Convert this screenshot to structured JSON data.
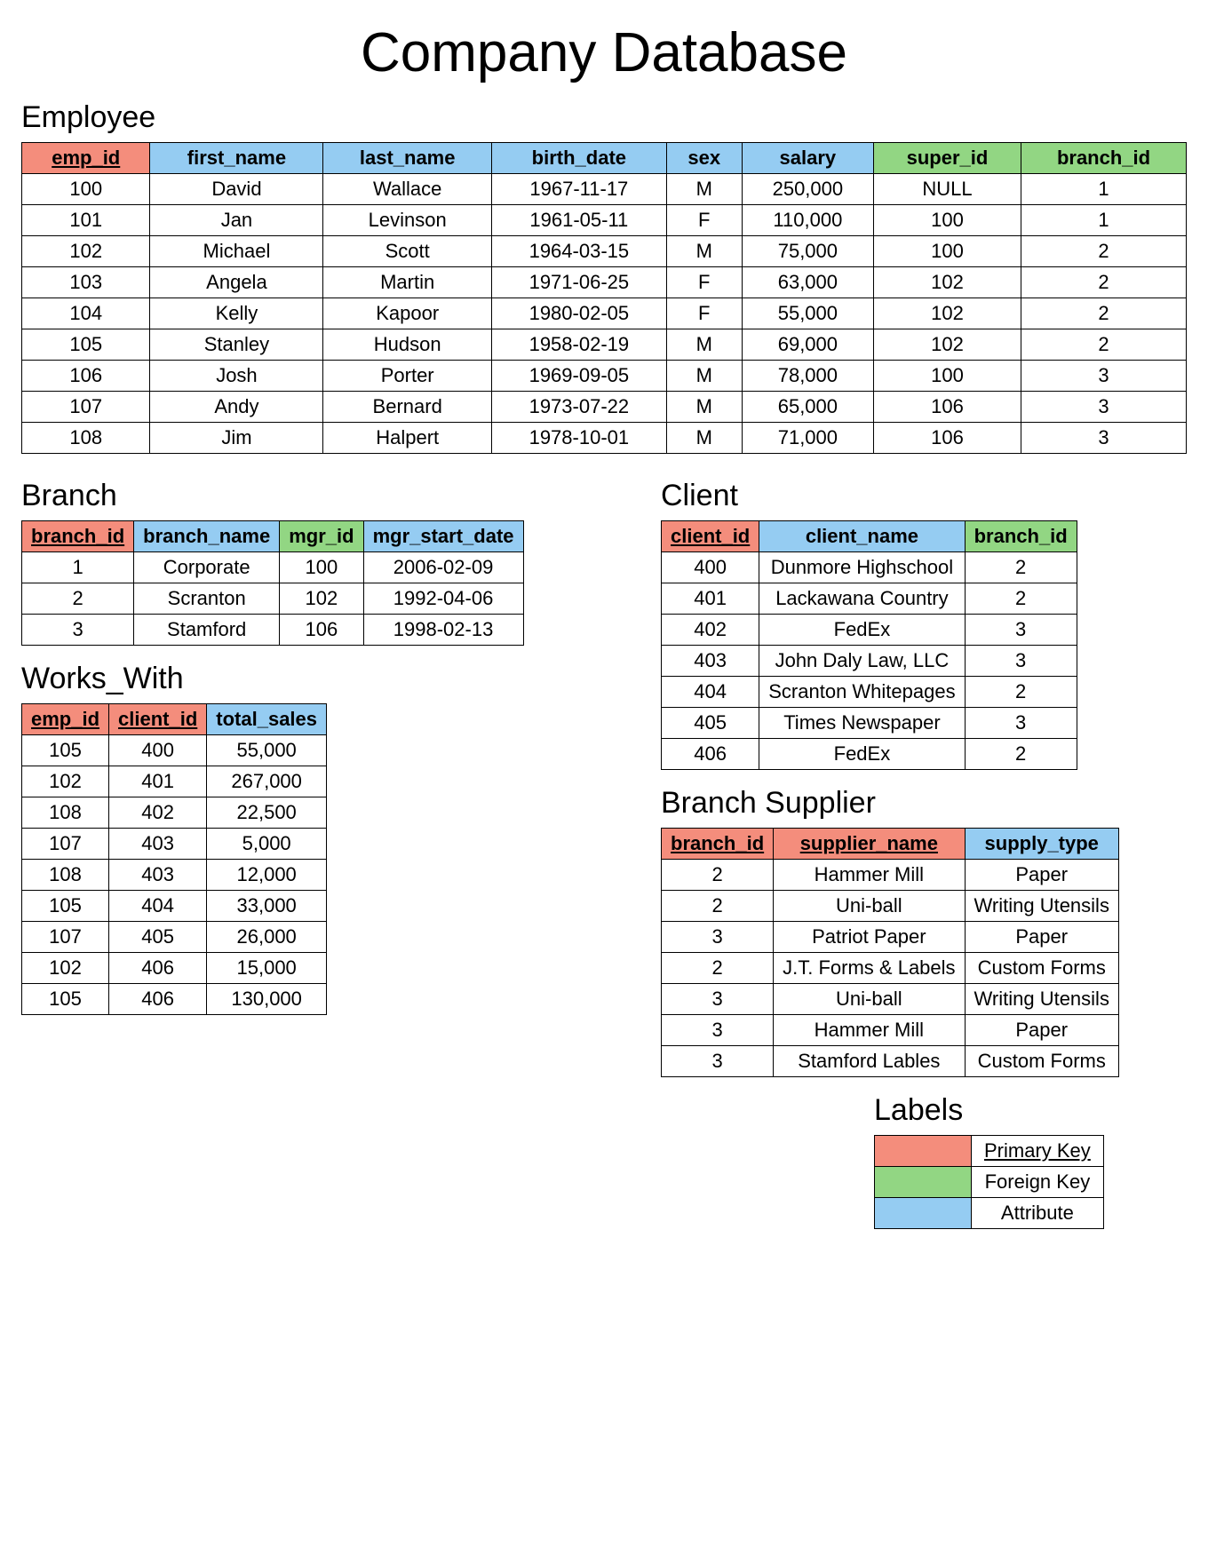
{
  "title": "Company Database",
  "employee": {
    "heading": "Employee",
    "columns": [
      {
        "key": "emp_id",
        "label": "emp_id",
        "kind": "pk"
      },
      {
        "key": "first_name",
        "label": "first_name",
        "kind": "attr"
      },
      {
        "key": "last_name",
        "label": "last_name",
        "kind": "attr"
      },
      {
        "key": "birth_date",
        "label": "birth_date",
        "kind": "attr"
      },
      {
        "key": "sex",
        "label": "sex",
        "kind": "attr"
      },
      {
        "key": "salary",
        "label": "salary",
        "kind": "attr"
      },
      {
        "key": "super_id",
        "label": "super_id",
        "kind": "fk"
      },
      {
        "key": "branch_id",
        "label": "branch_id",
        "kind": "fk"
      }
    ],
    "rows": [
      {
        "emp_id": "100",
        "first_name": "David",
        "last_name": "Wallace",
        "birth_date": "1967-11-17",
        "sex": "M",
        "salary": "250,000",
        "super_id": "NULL",
        "branch_id": "1"
      },
      {
        "emp_id": "101",
        "first_name": "Jan",
        "last_name": "Levinson",
        "birth_date": "1961-05-11",
        "sex": "F",
        "salary": "110,000",
        "super_id": "100",
        "branch_id": "1"
      },
      {
        "emp_id": "102",
        "first_name": "Michael",
        "last_name": "Scott",
        "birth_date": "1964-03-15",
        "sex": "M",
        "salary": "75,000",
        "super_id": "100",
        "branch_id": "2"
      },
      {
        "emp_id": "103",
        "first_name": "Angela",
        "last_name": "Martin",
        "birth_date": "1971-06-25",
        "sex": "F",
        "salary": "63,000",
        "super_id": "102",
        "branch_id": "2"
      },
      {
        "emp_id": "104",
        "first_name": "Kelly",
        "last_name": "Kapoor",
        "birth_date": "1980-02-05",
        "sex": "F",
        "salary": "55,000",
        "super_id": "102",
        "branch_id": "2"
      },
      {
        "emp_id": "105",
        "first_name": "Stanley",
        "last_name": "Hudson",
        "birth_date": "1958-02-19",
        "sex": "M",
        "salary": "69,000",
        "super_id": "102",
        "branch_id": "2"
      },
      {
        "emp_id": "106",
        "first_name": "Josh",
        "last_name": "Porter",
        "birth_date": "1969-09-05",
        "sex": "M",
        "salary": "78,000",
        "super_id": "100",
        "branch_id": "3"
      },
      {
        "emp_id": "107",
        "first_name": "Andy",
        "last_name": "Bernard",
        "birth_date": "1973-07-22",
        "sex": "M",
        "salary": "65,000",
        "super_id": "106",
        "branch_id": "3"
      },
      {
        "emp_id": "108",
        "first_name": "Jim",
        "last_name": "Halpert",
        "birth_date": "1978-10-01",
        "sex": "M",
        "salary": "71,000",
        "super_id": "106",
        "branch_id": "3"
      }
    ]
  },
  "branch": {
    "heading": "Branch",
    "columns": [
      {
        "key": "branch_id",
        "label": "branch_id",
        "kind": "pk"
      },
      {
        "key": "branch_name",
        "label": "branch_name",
        "kind": "attr"
      },
      {
        "key": "mgr_id",
        "label": "mgr_id",
        "kind": "fk"
      },
      {
        "key": "mgr_start_date",
        "label": "mgr_start_date",
        "kind": "attr"
      }
    ],
    "rows": [
      {
        "branch_id": "1",
        "branch_name": "Corporate",
        "mgr_id": "100",
        "mgr_start_date": "2006-02-09"
      },
      {
        "branch_id": "2",
        "branch_name": "Scranton",
        "mgr_id": "102",
        "mgr_start_date": "1992-04-06"
      },
      {
        "branch_id": "3",
        "branch_name": "Stamford",
        "mgr_id": "106",
        "mgr_start_date": "1998-02-13"
      }
    ]
  },
  "works_with": {
    "heading": "Works_With",
    "columns": [
      {
        "key": "emp_id",
        "label": "emp_id",
        "kind": "pk"
      },
      {
        "key": "client_id",
        "label": "client_id",
        "kind": "pk"
      },
      {
        "key": "total_sales",
        "label": "total_sales",
        "kind": "attr"
      }
    ],
    "rows": [
      {
        "emp_id": "105",
        "client_id": "400",
        "total_sales": "55,000"
      },
      {
        "emp_id": "102",
        "client_id": "401",
        "total_sales": "267,000"
      },
      {
        "emp_id": "108",
        "client_id": "402",
        "total_sales": "22,500"
      },
      {
        "emp_id": "107",
        "client_id": "403",
        "total_sales": "5,000"
      },
      {
        "emp_id": "108",
        "client_id": "403",
        "total_sales": "12,000"
      },
      {
        "emp_id": "105",
        "client_id": "404",
        "total_sales": "33,000"
      },
      {
        "emp_id": "107",
        "client_id": "405",
        "total_sales": "26,000"
      },
      {
        "emp_id": "102",
        "client_id": "406",
        "total_sales": "15,000"
      },
      {
        "emp_id": "105",
        "client_id": "406",
        "total_sales": "130,000"
      }
    ]
  },
  "client": {
    "heading": "Client",
    "columns": [
      {
        "key": "client_id",
        "label": "client_id",
        "kind": "pk"
      },
      {
        "key": "client_name",
        "label": "client_name",
        "kind": "attr"
      },
      {
        "key": "branch_id",
        "label": "branch_id",
        "kind": "fk"
      }
    ],
    "rows": [
      {
        "client_id": "400",
        "client_name": "Dunmore Highschool",
        "branch_id": "2"
      },
      {
        "client_id": "401",
        "client_name": "Lackawana Country",
        "branch_id": "2"
      },
      {
        "client_id": "402",
        "client_name": "FedEx",
        "branch_id": "3"
      },
      {
        "client_id": "403",
        "client_name": "John Daly Law, LLC",
        "branch_id": "3"
      },
      {
        "client_id": "404",
        "client_name": "Scranton Whitepages",
        "branch_id": "2"
      },
      {
        "client_id": "405",
        "client_name": "Times Newspaper",
        "branch_id": "3"
      },
      {
        "client_id": "406",
        "client_name": "FedEx",
        "branch_id": "2"
      }
    ]
  },
  "branch_supplier": {
    "heading": "Branch Supplier",
    "columns": [
      {
        "key": "branch_id",
        "label": "branch_id",
        "kind": "pk"
      },
      {
        "key": "supplier_name",
        "label": "supplier_name",
        "kind": "pk"
      },
      {
        "key": "supply_type",
        "label": "supply_type",
        "kind": "attr"
      }
    ],
    "rows": [
      {
        "branch_id": "2",
        "supplier_name": "Hammer Mill",
        "supply_type": "Paper"
      },
      {
        "branch_id": "2",
        "supplier_name": "Uni-ball",
        "supply_type": "Writing Utensils"
      },
      {
        "branch_id": "3",
        "supplier_name": "Patriot Paper",
        "supply_type": "Paper"
      },
      {
        "branch_id": "2",
        "supplier_name": "J.T. Forms & Labels",
        "supply_type": "Custom Forms"
      },
      {
        "branch_id": "3",
        "supplier_name": "Uni-ball",
        "supply_type": "Writing Utensils"
      },
      {
        "branch_id": "3",
        "supplier_name": "Hammer Mill",
        "supply_type": "Paper"
      },
      {
        "branch_id": "3",
        "supplier_name": "Stamford Lables",
        "supply_type": "Custom Forms"
      }
    ]
  },
  "legend": {
    "heading": "Labels",
    "rows": [
      {
        "kind": "pk",
        "label": "Primary Key",
        "underline": true
      },
      {
        "kind": "fk",
        "label": "Foreign Key",
        "underline": false
      },
      {
        "kind": "attr",
        "label": "Attribute",
        "underline": false
      }
    ]
  },
  "colors": {
    "pk": "#f48d7c",
    "fk": "#92d683",
    "attr": "#95ccf2"
  }
}
